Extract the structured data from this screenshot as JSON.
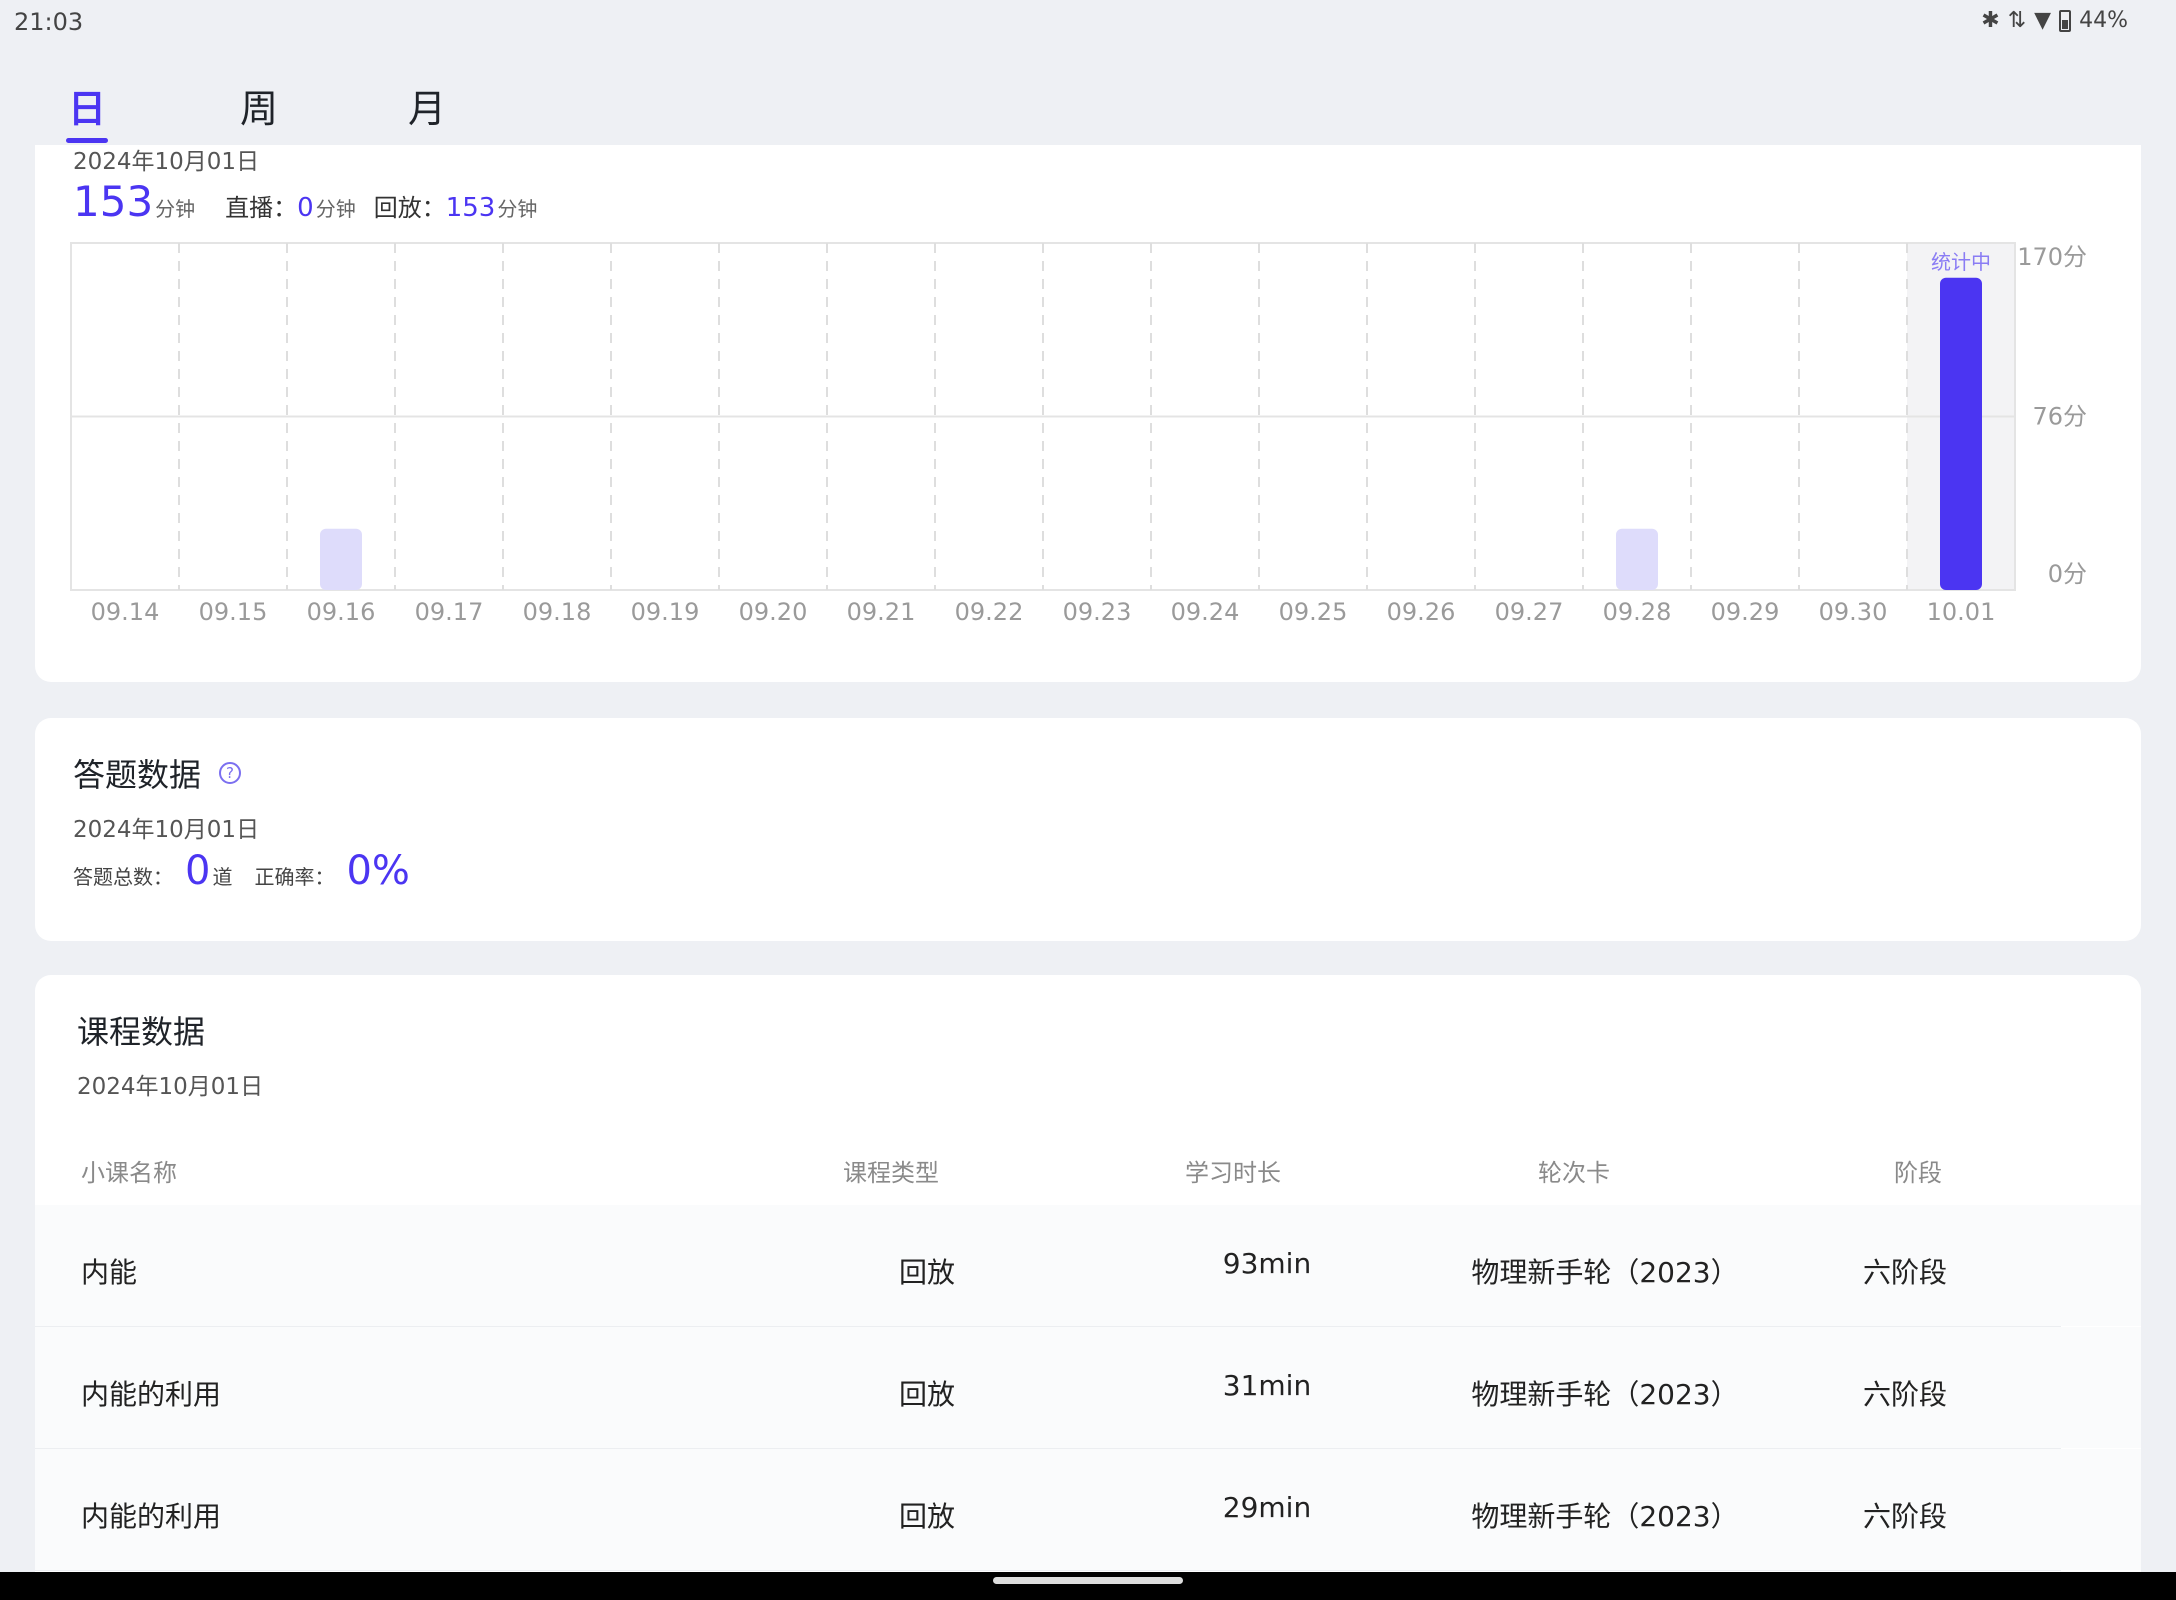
{
  "status": {
    "time": "21:03",
    "battery": "44%",
    "icons": [
      "bluetooth-icon",
      "signal-icon",
      "wifi-icon",
      "battery-icon"
    ]
  },
  "tabs": [
    {
      "label": "日",
      "active": true
    },
    {
      "label": "周",
      "active": false
    },
    {
      "label": "月",
      "active": false
    }
  ],
  "study": {
    "date": "2024年10月01日",
    "total": "153",
    "total_unit": "分钟",
    "live_label": "直播：",
    "live_value": "0",
    "live_unit": "分钟",
    "replay_label": "回放：",
    "replay_value": "153",
    "replay_unit": "分钟"
  },
  "chart_data": {
    "type": "bar",
    "categories": [
      "09.14",
      "09.15",
      "09.16",
      "09.17",
      "09.18",
      "09.19",
      "09.20",
      "09.21",
      "09.22",
      "09.23",
      "09.24",
      "09.25",
      "09.26",
      "09.27",
      "09.28",
      "09.29",
      "09.30",
      "10.01"
    ],
    "values": [
      0,
      0,
      30,
      0,
      0,
      0,
      0,
      0,
      0,
      0,
      0,
      0,
      0,
      0,
      30,
      0,
      0,
      153
    ],
    "ylim": [
      0,
      170
    ],
    "yticks": [
      "170分",
      "76分",
      "0分"
    ],
    "highlight_label": "统计中",
    "colors": {
      "highlight": "#4b35f2",
      "normal": "#dedcfb"
    },
    "grid": true
  },
  "answer": {
    "title": "答题数据",
    "help_icon": "question-circle-icon",
    "date": "2024年10月01日",
    "total_label": "答题总数：",
    "total_value": "0",
    "total_unit": "道",
    "rate_label": "正确率：",
    "rate_value": "0%"
  },
  "course": {
    "title": "课程数据",
    "date": "2024年10月01日",
    "columns": [
      "小课名称",
      "课程类型",
      "学习时长",
      "轮次卡",
      "阶段"
    ],
    "rows": [
      {
        "name": "内能",
        "type": "回放",
        "duration": "93min",
        "round": "物理新手轮（2023）",
        "stage": "六阶段"
      },
      {
        "name": "内能的利用",
        "type": "回放",
        "duration": "31min",
        "round": "物理新手轮（2023）",
        "stage": "六阶段"
      },
      {
        "name": "内能的利用",
        "type": "回放",
        "duration": "29min",
        "round": "物理新手轮（2023）",
        "stage": "六阶段"
      }
    ]
  }
}
